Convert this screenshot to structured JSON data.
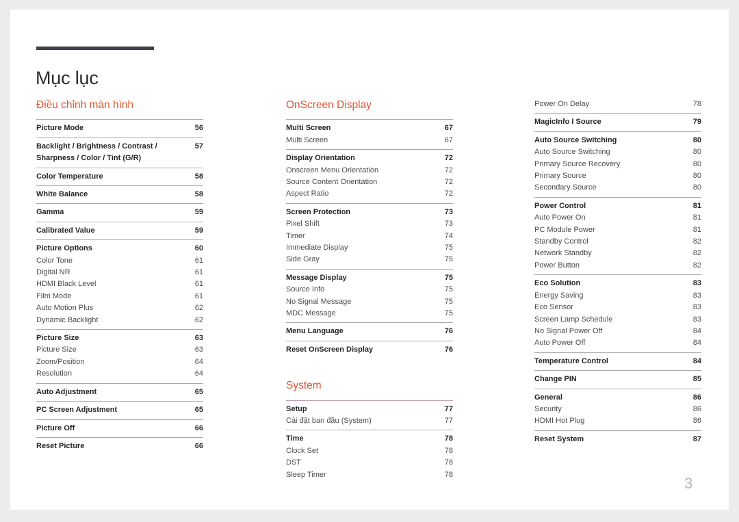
{
  "document": {
    "title": "Mục lục",
    "page_number": "3",
    "accent_color": "#df5330",
    "title_bar_color": "#403e48",
    "rule_color": "#a9a9a9",
    "warm_rule_color": "#c0a3ae",
    "page_number_color": "#b5b5ba"
  },
  "columns": [
    {
      "id": "column-1",
      "sections": [
        {
          "heading": "Điều chỉnh màn hình",
          "groups": [
            {
              "rule": "plain",
              "entries": [
                {
                  "label": "Picture Mode",
                  "page": "56",
                  "level": "major"
                }
              ]
            },
            {
              "rule": "plain",
              "entries": [
                {
                  "label": "Backlight / Brightness / Contrast / Sharpness / Color / Tint (G/R)",
                  "page": "57",
                  "level": "major",
                  "wrap": true
                }
              ]
            },
            {
              "rule": "plain",
              "entries": [
                {
                  "label": "Color Temperature",
                  "page": "58",
                  "level": "major"
                }
              ]
            },
            {
              "rule": "plain",
              "entries": [
                {
                  "label": "White Balance",
                  "page": "58",
                  "level": "major"
                }
              ]
            },
            {
              "rule": "plain",
              "entries": [
                {
                  "label": "Gamma",
                  "page": "59",
                  "level": "major"
                }
              ]
            },
            {
              "rule": "plain",
              "entries": [
                {
                  "label": "Calibrated Value",
                  "page": "59",
                  "level": "major"
                }
              ]
            },
            {
              "rule": "plain",
              "entries": [
                {
                  "label": "Picture Options",
                  "page": "60",
                  "level": "major"
                },
                {
                  "label": "Color Tone",
                  "page": "61",
                  "level": "minor"
                },
                {
                  "label": "Digital NR",
                  "page": "61",
                  "level": "minor"
                },
                {
                  "label": "HDMI Black Level",
                  "page": "61",
                  "level": "minor"
                },
                {
                  "label": "Film Mode",
                  "page": "61",
                  "level": "minor"
                },
                {
                  "label": "Auto Motion Plus",
                  "page": "62",
                  "level": "minor"
                },
                {
                  "label": "Dynamic Backlight",
                  "page": "62",
                  "level": "minor"
                }
              ]
            },
            {
              "rule": "plain",
              "entries": [
                {
                  "label": "Picture Size",
                  "page": "63",
                  "level": "major"
                },
                {
                  "label": "Picture Size",
                  "page": "63",
                  "level": "minor"
                },
                {
                  "label": "Zoom/Position",
                  "page": "64",
                  "level": "minor"
                },
                {
                  "label": "Resolution",
                  "page": "64",
                  "level": "minor"
                }
              ]
            },
            {
              "rule": "plain",
              "entries": [
                {
                  "label": "Auto Adjustment",
                  "page": "65",
                  "level": "major"
                }
              ]
            },
            {
              "rule": "plain",
              "entries": [
                {
                  "label": "PC Screen Adjustment",
                  "page": "65",
                  "level": "major"
                }
              ]
            },
            {
              "rule": "plain",
              "entries": [
                {
                  "label": "Picture Off",
                  "page": "66",
                  "level": "major"
                }
              ]
            },
            {
              "rule": "plain",
              "entries": [
                {
                  "label": "Reset Picture",
                  "page": "66",
                  "level": "major"
                }
              ]
            }
          ]
        }
      ]
    },
    {
      "id": "column-2",
      "sections": [
        {
          "heading": "OnScreen Display",
          "groups": [
            {
              "rule": "plain",
              "entries": [
                {
                  "label": "Multi Screen",
                  "page": "67",
                  "level": "major"
                },
                {
                  "label": "Multi Screen",
                  "page": "67",
                  "level": "minor"
                }
              ]
            },
            {
              "rule": "plain",
              "entries": [
                {
                  "label": "Display Orientation",
                  "page": "72",
                  "level": "major"
                },
                {
                  "label": "Onscreen Menu Orientation",
                  "page": "72",
                  "level": "minor"
                },
                {
                  "label": "Source Content Orientation",
                  "page": "72",
                  "level": "minor"
                },
                {
                  "label": "Aspect Ratio",
                  "page": "72",
                  "level": "minor"
                }
              ]
            },
            {
              "rule": "plain",
              "entries": [
                {
                  "label": "Screen Protection",
                  "page": "73",
                  "level": "major"
                },
                {
                  "label": "Pixel Shift",
                  "page": "73",
                  "level": "minor"
                },
                {
                  "label": "Timer",
                  "page": "74",
                  "level": "minor"
                },
                {
                  "label": "Immediate Display",
                  "page": "75",
                  "level": "minor"
                },
                {
                  "label": "Side Gray",
                  "page": "75",
                  "level": "minor"
                }
              ]
            },
            {
              "rule": "plain",
              "entries": [
                {
                  "label": "Message Display",
                  "page": "75",
                  "level": "major"
                },
                {
                  "label": "Source Info",
                  "page": "75",
                  "level": "minor"
                },
                {
                  "label": "No Signal Message",
                  "page": "75",
                  "level": "minor"
                },
                {
                  "label": "MDC Message",
                  "page": "75",
                  "level": "minor"
                }
              ]
            },
            {
              "rule": "plain",
              "entries": [
                {
                  "label": "Menu Language",
                  "page": "76",
                  "level": "major"
                }
              ]
            },
            {
              "rule": "plain",
              "entries": [
                {
                  "label": "Reset OnScreen Display",
                  "page": "76",
                  "level": "major"
                }
              ]
            }
          ]
        },
        {
          "heading": "System",
          "spaced": true,
          "groups": [
            {
              "rule": "warm",
              "entries": [
                {
                  "label": "Setup",
                  "page": "77",
                  "level": "major"
                },
                {
                  "label": "Cài đặt ban đầu (System)",
                  "page": "77",
                  "level": "minor"
                }
              ]
            },
            {
              "rule": "plain",
              "entries": [
                {
                  "label": "Time",
                  "page": "78",
                  "level": "major"
                },
                {
                  "label": "Clock Set",
                  "page": "78",
                  "level": "minor"
                },
                {
                  "label": "DST",
                  "page": "78",
                  "level": "minor"
                },
                {
                  "label": "Sleep Timer",
                  "page": "78",
                  "level": "minor"
                }
              ]
            }
          ]
        }
      ]
    },
    {
      "id": "column-3",
      "sections": [
        {
          "heading": "",
          "groups": [
            {
              "rule": "none",
              "entries": [
                {
                  "label": "Power On Delay",
                  "page": "78",
                  "level": "minor"
                }
              ]
            },
            {
              "rule": "plain",
              "entries": [
                {
                  "label": "MagicInfo I Source",
                  "page": "79",
                  "level": "major"
                }
              ]
            },
            {
              "rule": "warm",
              "entries": [
                {
                  "label": "Auto Source Switching",
                  "page": "80",
                  "level": "major"
                },
                {
                  "label": "Auto Source Switching",
                  "page": "80",
                  "level": "minor"
                },
                {
                  "label": "Primary Source Recovery",
                  "page": "80",
                  "level": "minor"
                },
                {
                  "label": "Primary Source",
                  "page": "80",
                  "level": "minor"
                },
                {
                  "label": "Secondary Source",
                  "page": "80",
                  "level": "minor"
                }
              ]
            },
            {
              "rule": "plain",
              "entries": [
                {
                  "label": "Power Control",
                  "page": "81",
                  "level": "major"
                },
                {
                  "label": "Auto Power On",
                  "page": "81",
                  "level": "minor"
                },
                {
                  "label": "PC Module Power",
                  "page": "81",
                  "level": "minor"
                },
                {
                  "label": "Standby Control",
                  "page": "82",
                  "level": "minor"
                },
                {
                  "label": "Network Standby",
                  "page": "82",
                  "level": "minor"
                },
                {
                  "label": "Power Button",
                  "page": "82",
                  "level": "minor"
                }
              ]
            },
            {
              "rule": "plain",
              "entries": [
                {
                  "label": "Eco Solution",
                  "page": "83",
                  "level": "major"
                },
                {
                  "label": "Energy Saving",
                  "page": "83",
                  "level": "minor"
                },
                {
                  "label": "Eco Sensor",
                  "page": "83",
                  "level": "minor"
                },
                {
                  "label": "Screen Lamp Schedule",
                  "page": "83",
                  "level": "minor"
                },
                {
                  "label": "No Signal Power Off",
                  "page": "84",
                  "level": "minor"
                },
                {
                  "label": "Auto Power Off",
                  "page": "84",
                  "level": "minor"
                }
              ]
            },
            {
              "rule": "plain",
              "entries": [
                {
                  "label": "Temperature Control",
                  "page": "84",
                  "level": "major"
                }
              ]
            },
            {
              "rule": "plain",
              "entries": [
                {
                  "label": "Change PIN",
                  "page": "85",
                  "level": "major"
                }
              ]
            },
            {
              "rule": "plain",
              "entries": [
                {
                  "label": "General",
                  "page": "86",
                  "level": "major"
                },
                {
                  "label": "Security",
                  "page": "86",
                  "level": "minor"
                },
                {
                  "label": "HDMI Hot Plug",
                  "page": "86",
                  "level": "minor"
                }
              ]
            },
            {
              "rule": "plain",
              "entries": [
                {
                  "label": "Reset System",
                  "page": "87",
                  "level": "major"
                }
              ]
            }
          ]
        }
      ]
    }
  ]
}
